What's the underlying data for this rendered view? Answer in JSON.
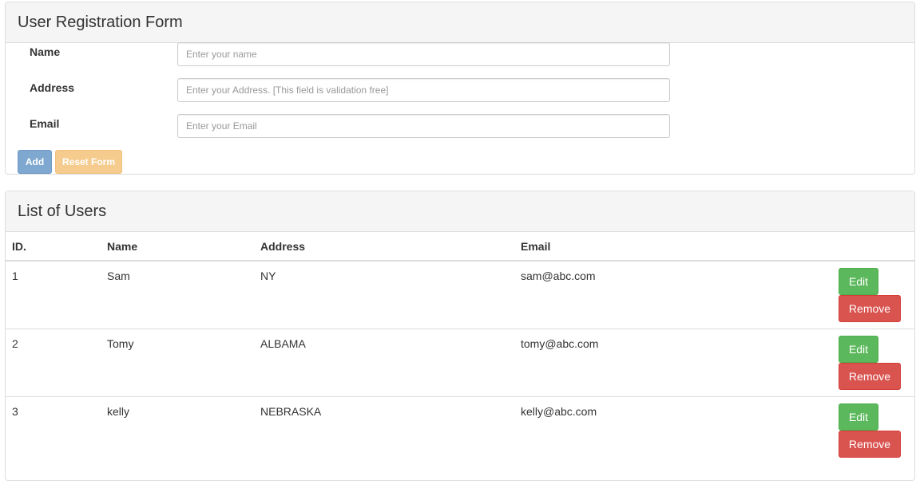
{
  "form": {
    "title": "User Registration Form",
    "fields": [
      {
        "label": "Name",
        "placeholder": "Enter your name",
        "value": ""
      },
      {
        "label": "Address",
        "placeholder": "Enter your Address. [This field is validation free]",
        "value": ""
      },
      {
        "label": "Email",
        "placeholder": "Enter your Email",
        "value": ""
      }
    ],
    "add_label": "Add",
    "reset_label": "Reset Form"
  },
  "users": {
    "title": "List of Users",
    "columns": [
      "ID.",
      "Name",
      "Address",
      "Email"
    ],
    "rows": [
      {
        "id": "1",
        "name": "Sam",
        "address": "NY",
        "email": "sam@abc.com"
      },
      {
        "id": "2",
        "name": "Tomy",
        "address": "ALBAMA",
        "email": "tomy@abc.com"
      },
      {
        "id": "3",
        "name": "kelly",
        "address": "NEBRASKA",
        "email": "kelly@abc.com"
      }
    ],
    "edit_label": "Edit",
    "remove_label": "Remove"
  },
  "colors": {
    "primary_disabled": "#7fa8d0",
    "warning_disabled": "#f5cb8e",
    "success": "#5cb85c",
    "danger": "#d9534f",
    "panel_heading_bg": "#f5f5f5"
  }
}
